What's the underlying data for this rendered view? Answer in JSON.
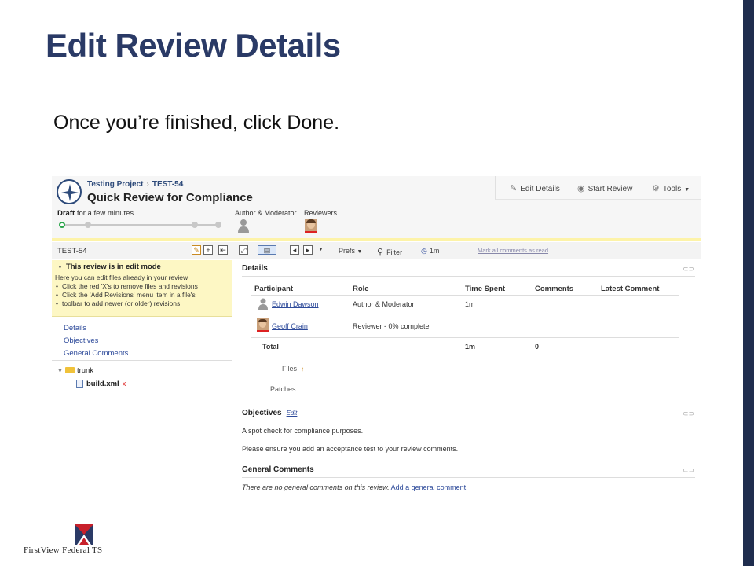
{
  "slide": {
    "title": "Edit Review Details",
    "body": "Once you’re finished, click Done.",
    "footer_brand": "FirstView Federal TS"
  },
  "colors": {
    "title": "#2a3a66",
    "side_bar": "#1f2d4e",
    "link": "#2d4a9a",
    "highlight": "#fdf7c4"
  },
  "app": {
    "breadcrumb": {
      "project": "Testing Project",
      "review_id": "TEST-54"
    },
    "review_title": "Quick Review for Compliance",
    "status": {
      "state": "Draft",
      "duration": "for a few minutes"
    },
    "roles_header": {
      "author": "Author & Moderator",
      "reviewers": "Reviewers"
    },
    "actions": {
      "edit_details": "Edit Details",
      "start_review": "Start Review",
      "tools": "Tools"
    },
    "toolbar": {
      "review_name": "TEST-54",
      "prefs": "Prefs",
      "filter": "Filter",
      "timer": "1m",
      "mark_all_read": "Mark all comments as read"
    },
    "edit_mode": {
      "heading": "This review is in edit mode",
      "intro": "Here you can edit files already in your review",
      "tips": [
        "Click the red 'X's to remove files and revisions",
        "Click the 'Add Revisions' menu item in a file's",
        "toolbar to add newer (or older) revisions"
      ]
    },
    "nav": [
      "Details",
      "Objectives",
      "General Comments"
    ],
    "tree": {
      "folder": "trunk",
      "file": "build.xml",
      "remove_mark": "x"
    },
    "details": {
      "heading": "Details",
      "columns": [
        "Participant",
        "Role",
        "Time Spent",
        "Comments",
        "Latest Comment"
      ],
      "rows": [
        {
          "participant": "Edwin Dawson",
          "role": "Author & Moderator",
          "time": "1m"
        },
        {
          "participant": "Geoff Crain",
          "role": "Reviewer - 0% complete",
          "time": ""
        }
      ],
      "total": {
        "label": "Total",
        "time": "1m",
        "comments": "0"
      },
      "files_label": "Files",
      "files_mark": "↑",
      "patches_label": "Patches"
    },
    "objectives": {
      "heading": "Objectives",
      "edit_link": "Edit",
      "lines": [
        "A spot check for compliance purposes.",
        "Please ensure you add an acceptance test to your review comments."
      ]
    },
    "general_comments": {
      "heading": "General Comments",
      "empty_text": "There are no general comments on this review.",
      "add_link": "Add a general comment"
    }
  }
}
